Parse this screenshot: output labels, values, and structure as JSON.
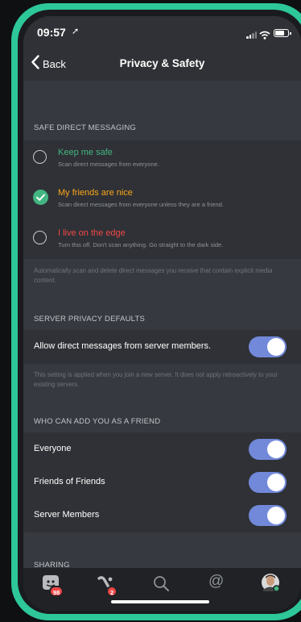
{
  "status": {
    "time": "09:57"
  },
  "nav": {
    "back_label": "Back",
    "title": "Privacy & Safety"
  },
  "dm_section": {
    "header": "SAFE DIRECT MESSAGING",
    "options": [
      {
        "title": "Keep me safe",
        "description": "Scan direct messages from everyone.",
        "selected": false,
        "color": "#43b581"
      },
      {
        "title": "My friends are nice",
        "description": "Scan direct messages from everyone unless they are a friend.",
        "selected": true,
        "color": "#faa61a"
      },
      {
        "title": "I live on the edge",
        "description": "Turn this off. Don't scan anything. Go straight to the dark side.",
        "selected": false,
        "color": "#f04747"
      }
    ],
    "helper": "Automatically scan and delete direct messages you receive that contain explicit media content."
  },
  "server_section": {
    "header": "SERVER PRIVACY DEFAULTS",
    "toggle": {
      "label": "Allow direct messages from server members.",
      "on": true
    },
    "helper": "This setting is applied when you join a new server. It does not apply retroactively to your existing servers."
  },
  "friend_section": {
    "header": "WHO CAN ADD YOU AS A FRIEND",
    "toggles": [
      {
        "label": "Everyone",
        "on": true
      },
      {
        "label": "Friends of Friends",
        "on": true
      },
      {
        "label": "Server Members",
        "on": true
      }
    ]
  },
  "sharing_section": {
    "header": "SHARING"
  },
  "tabbar": {
    "home": {
      "icon": "discord-home-icon",
      "badge": "98"
    },
    "friends": {
      "icon": "friends-wave-icon",
      "badge": "2"
    },
    "search": {
      "icon": "search-icon"
    },
    "mentions": {
      "icon": "at-icon"
    },
    "profile": {
      "icon": "avatar"
    }
  },
  "colors": {
    "accent": "#7289da",
    "brand_frame": "#2dc79a",
    "online": "#43b581"
  }
}
